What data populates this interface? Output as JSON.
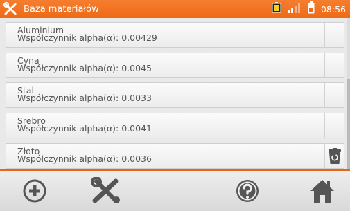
{
  "header": {
    "title": "Baza materiałów",
    "time": "08:56",
    "accent_color": "#ee6a17",
    "icons": [
      "tools-icon",
      "battery-icon",
      "signal-icon",
      "device-battery-icon"
    ]
  },
  "materials": [
    {
      "name": "Aluminium",
      "coefficient": "Współczynnik alpha(α): 0.00429"
    },
    {
      "name": "Cyna",
      "coefficient": "Współczynnik alpha(α): 0.0045"
    },
    {
      "name": "Stal",
      "coefficient": "Współczynnik alpha(α): 0.0033"
    },
    {
      "name": "Srebro",
      "coefficient": "Współczynnik alpha(α): 0.0041"
    },
    {
      "name": "Złoto",
      "coefficient": "Współczynnik alpha(α): 0.0036"
    }
  ],
  "footer": {
    "buttons": [
      "add-icon",
      "tools-icon",
      "help-icon",
      "home-icon"
    ]
  }
}
